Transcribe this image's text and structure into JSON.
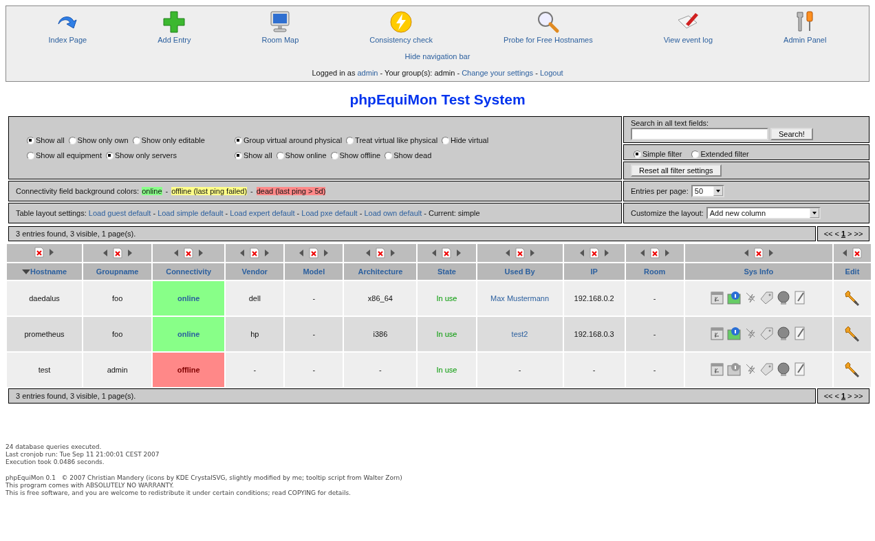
{
  "nav": {
    "items": [
      {
        "label": "Index Page"
      },
      {
        "label": "Add Entry"
      },
      {
        "label": "Room Map"
      },
      {
        "label": "Consistency check"
      },
      {
        "label": "Probe for Free Hostnames"
      },
      {
        "label": "View event log"
      },
      {
        "label": "Admin Panel"
      }
    ],
    "hide_link": "Hide navigation bar",
    "login": [
      {
        "kind": "text",
        "text": "Logged in as"
      },
      {
        "kind": "link",
        "text": "admin"
      },
      {
        "kind": "text",
        "text": "- Your group(s): admin -"
      },
      {
        "kind": "link",
        "text": "Change your settings"
      },
      {
        "kind": "text",
        "text": "-"
      },
      {
        "kind": "link",
        "text": "Logout"
      }
    ]
  },
  "title": "phpEquiMon Test System",
  "filters": {
    "groups": [
      [
        {
          "label": "Show all",
          "selected": true
        },
        {
          "label": "Show only own",
          "selected": false
        },
        {
          "label": "Show only editable",
          "selected": false
        }
      ],
      [
        {
          "label": "Group virtual around physical",
          "selected": true
        },
        {
          "label": "Treat virtual like physical",
          "selected": false
        },
        {
          "label": "Hide virtual",
          "selected": false
        }
      ],
      [
        {
          "label": "Show all equipment",
          "selected": false
        },
        {
          "label": "Show only servers",
          "selected": true
        }
      ],
      [
        {
          "label": "Show all",
          "selected": true
        },
        {
          "label": "Show online",
          "selected": false
        },
        {
          "label": "Show offline",
          "selected": false
        },
        {
          "label": "Show dead",
          "selected": false
        }
      ]
    ],
    "search_label": "Search in all text fields:",
    "search_button": "Search!",
    "modes": [
      {
        "label": "Simple filter",
        "selected": true
      },
      {
        "label": "Extended filter",
        "selected": false
      }
    ],
    "reset_button": "Reset all filter settings"
  },
  "legend": {
    "label": "Connectivity field background colors:",
    "separator": "-",
    "items": [
      {
        "text": "online",
        "color": "#88ff88"
      },
      {
        "text": "offline (last ping failed)",
        "color": "#ffff88"
      },
      {
        "text": "dead (last ping > 5d)",
        "color": "#ff8888"
      }
    ]
  },
  "entries_per_page": {
    "label": "Entries per page:",
    "value": "50"
  },
  "layout_settings": [
    {
      "kind": "text",
      "text": "Table layout settings:"
    },
    {
      "kind": "link",
      "text": "Load guest default"
    },
    {
      "kind": "text",
      "text": "-"
    },
    {
      "kind": "link",
      "text": "Load simple default"
    },
    {
      "kind": "text",
      "text": "-"
    },
    {
      "kind": "link",
      "text": "Load expert default"
    },
    {
      "kind": "text",
      "text": "-"
    },
    {
      "kind": "link",
      "text": "Load pxe default"
    },
    {
      "kind": "text",
      "text": "-"
    },
    {
      "kind": "link",
      "text": "Load own default"
    },
    {
      "kind": "text",
      "text": "- Current: simple"
    }
  ],
  "customize": {
    "label": "Customize the layout:",
    "value": "Add new column"
  },
  "summary_top": "3 entries found, 3 visible, 1 page(s).",
  "pager_top": [
    {
      "text": "<<",
      "current": false
    },
    {
      "text": "<",
      "current": false
    },
    {
      "text": "1",
      "current": true
    },
    {
      "text": ">",
      "current": false
    },
    {
      "text": ">>",
      "current": false
    }
  ],
  "table": {
    "columns": [
      {
        "label": "Hostname",
        "sorted": true,
        "move_left": false,
        "move_right": true
      },
      {
        "label": "Groupname",
        "sorted": false,
        "move_left": true,
        "move_right": true
      },
      {
        "label": "Connectivity",
        "sorted": false,
        "move_left": true,
        "move_right": true
      },
      {
        "label": "Vendor",
        "sorted": false,
        "move_left": true,
        "move_right": true
      },
      {
        "label": "Model",
        "sorted": false,
        "move_left": true,
        "move_right": true
      },
      {
        "label": "Architecture",
        "sorted": false,
        "move_left": true,
        "move_right": true
      },
      {
        "label": "State",
        "sorted": false,
        "move_left": true,
        "move_right": true
      },
      {
        "label": "Used By",
        "sorted": false,
        "move_left": true,
        "move_right": true
      },
      {
        "label": "IP",
        "sorted": false,
        "move_left": true,
        "move_right": true
      },
      {
        "label": "Room",
        "sorted": false,
        "move_left": true,
        "move_right": true
      },
      {
        "label": "Sys Info",
        "sorted": false,
        "move_left": true,
        "move_right": true
      },
      {
        "label": "Edit",
        "sorted": false,
        "move_left": true,
        "move_right": false
      }
    ],
    "rows": [
      {
        "hostname": "daedalus",
        "groupname": "foo",
        "connectivity": {
          "text": "online",
          "kind": "online",
          "color": "#88ff88"
        },
        "vendor": "dell",
        "model": "-",
        "architecture": "x86_64",
        "state": "In use",
        "used_by": {
          "text": "Max Mustermann",
          "link": true
        },
        "ip": "192.168.0.2",
        "room": "-",
        "sysinfo": [
          {
            "available": false
          },
          {
            "available": true
          },
          {
            "available": false
          },
          {
            "available": false
          },
          {
            "available": false
          },
          {
            "available": false
          }
        ]
      },
      {
        "hostname": "prometheus",
        "groupname": "foo",
        "connectivity": {
          "text": "online",
          "kind": "online",
          "color": "#88ff88"
        },
        "vendor": "hp",
        "model": "-",
        "architecture": "i386",
        "state": "In use",
        "used_by": {
          "text": "test2",
          "link": true
        },
        "ip": "192.168.0.3",
        "room": "-",
        "sysinfo": [
          {
            "available": false
          },
          {
            "available": true
          },
          {
            "available": false
          },
          {
            "available": false
          },
          {
            "available": false
          },
          {
            "available": false
          }
        ]
      },
      {
        "hostname": "test",
        "groupname": "admin",
        "connectivity": {
          "text": "offline",
          "kind": "offline",
          "color": "#ff8888"
        },
        "vendor": "-",
        "model": "-",
        "architecture": "-",
        "state": "In use",
        "used_by": {
          "text": "-",
          "link": false
        },
        "ip": "-",
        "room": "-",
        "sysinfo": [
          {
            "available": false
          },
          {
            "available": false
          },
          {
            "available": false
          },
          {
            "available": false
          },
          {
            "available": false
          },
          {
            "available": false
          }
        ]
      }
    ]
  },
  "summary_bottom": "3 entries found, 3 visible, 1 page(s).",
  "pager_bottom": [
    {
      "text": "<<",
      "current": false
    },
    {
      "text": "<",
      "current": false
    },
    {
      "text": "1",
      "current": true
    },
    {
      "text": ">",
      "current": false
    },
    {
      "text": ">>",
      "current": false
    }
  ],
  "footer": [
    [
      "24 database queries executed.",
      "Last cronjob run: Tue Sep 11 21:00:01 CEST 2007",
      "Execution took 0.0486 seconds."
    ],
    [
      "phpEquiMon 0.1   © 2007 Christian Mandery (icons by KDE CrystalSVG, slightly modified by me; tooltip script from Walter Zorn)",
      "This program comes with ABSOLUTELY NO WARRANTY.",
      "This is free software, and you are welcome to redistribute it under certain conditions; read COPYING for details."
    ]
  ]
}
